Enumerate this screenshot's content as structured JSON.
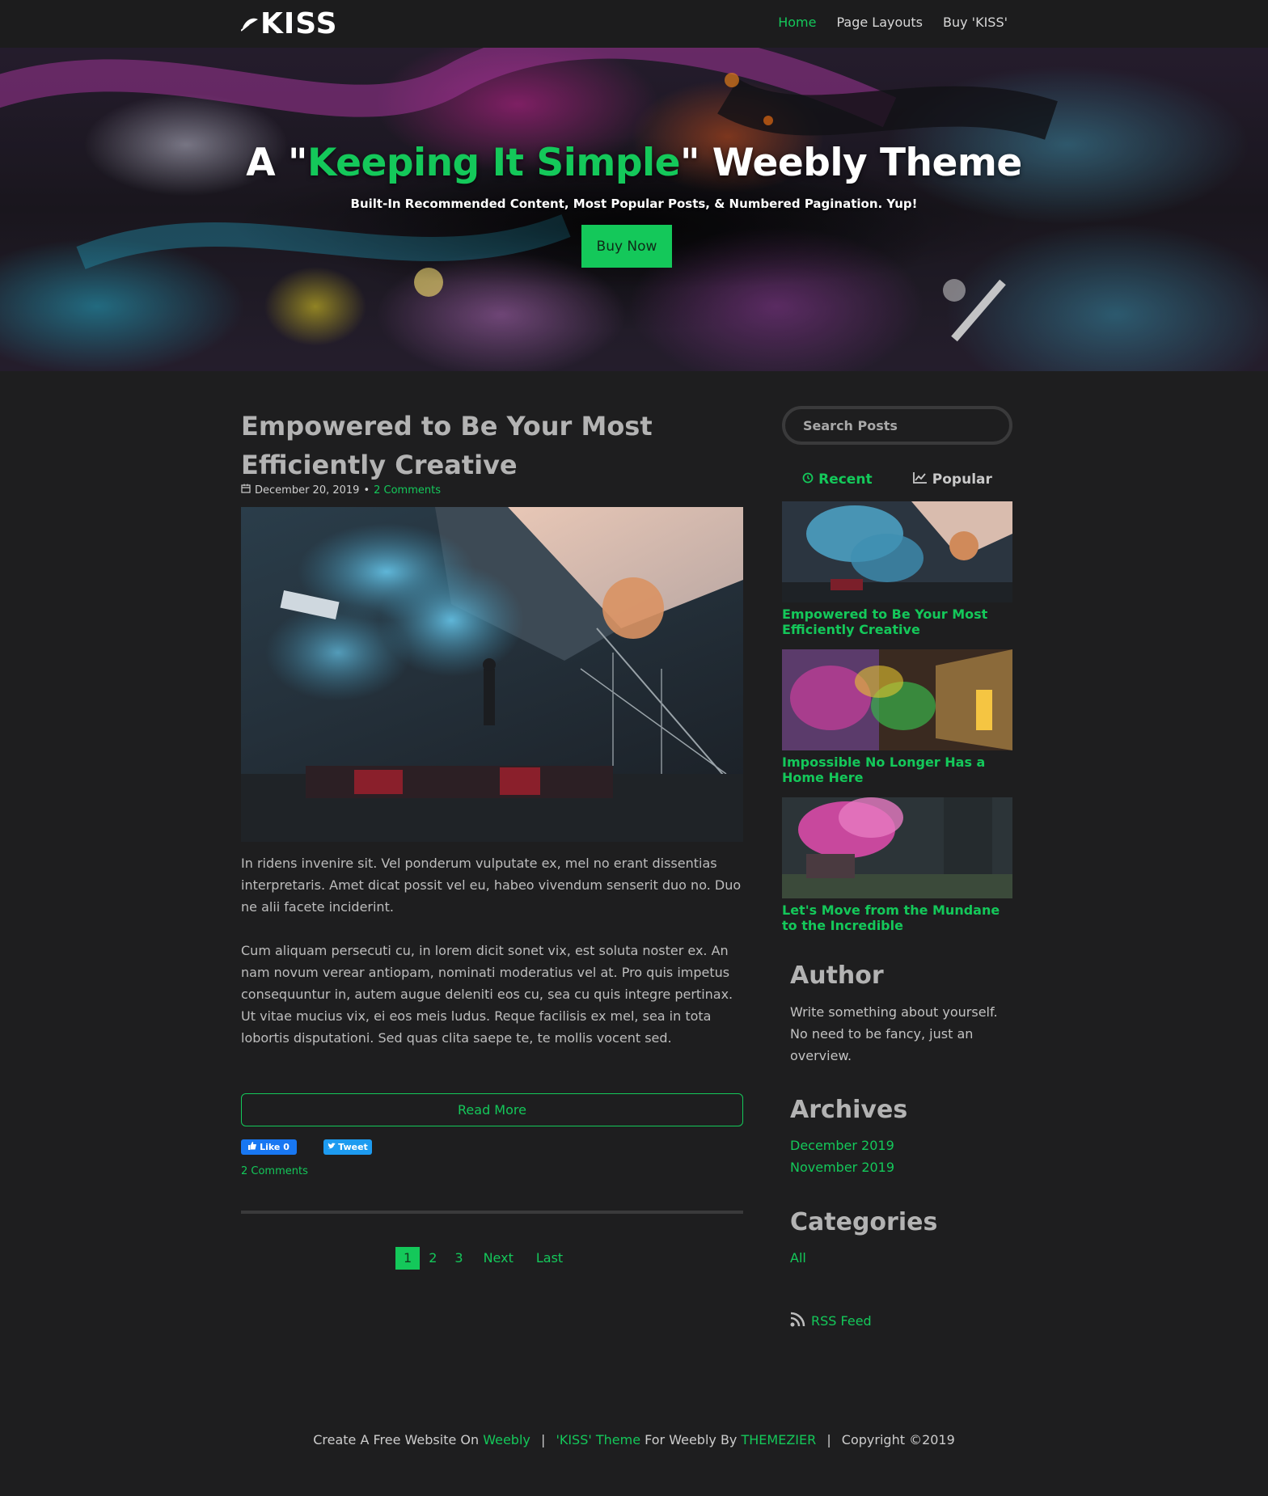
{
  "brand": {
    "logo_text": "KISS"
  },
  "nav": {
    "items": [
      "Home",
      "Page Layouts",
      "Buy 'KISS'"
    ],
    "active": "Home"
  },
  "hero": {
    "title_before": "A \"",
    "title_highlight": "Keeping It Simple",
    "title_after": "\" Weebly Theme",
    "subtitle": "Built-In Recommended Content, Most Popular Posts, & Numbered Pagination. Yup!",
    "button": "Buy Now"
  },
  "post": {
    "title": "Empowered to Be Your Most Efficiently Creative",
    "date": "December 20, 2019",
    "bullet": "•",
    "comments": "2 Comments",
    "paragraphs": [
      "In ridens invenire sit. Vel ponderum vulputate ex, mel no erant dissentias interpretaris. Amet dicat possit vel eu, habeo vivendum senserit duo no. Duo ne alii facete inciderint.",
      "Cum aliquam persecuti cu, in lorem dicit sonet vix, est soluta noster ex. An nam novum verear antiopam, nominati moderatius vel at. Pro quis impetus consequuntur in, autem augue deleniti eos cu, sea cu quis integre pertinax. Ut vitae mucius vix, ei eos meis ludus. Reque facilisis ex mel, sea in tota lobortis disputationi. Sed quas clita saepe te, te mollis vocent sed."
    ],
    "read_more": "Read More",
    "like_label": "Like 0",
    "tweet_label": "Tweet",
    "comments_link": "2 Comments"
  },
  "pagination": {
    "pages": [
      "1",
      "2",
      "3"
    ],
    "current": "1",
    "next": "Next",
    "last": "Last"
  },
  "sidebar": {
    "search_placeholder": "Search Posts",
    "tabs": {
      "recent": "Recent",
      "popular": "Popular"
    },
    "recent_posts": [
      "Empowered to Be Your Most Efficiently Creative",
      "Impossible No Longer Has a Home Here",
      "Let's Move from the Mundane to the Incredible"
    ],
    "author": {
      "heading": "Author",
      "text": "Write something about yourself. No need to be fancy, just an overview."
    },
    "archives": {
      "heading": "Archives",
      "items": [
        "December 2019",
        "November 2019"
      ]
    },
    "categories": {
      "heading": "Categories",
      "items": [
        "All"
      ]
    },
    "rss": "RSS Feed"
  },
  "footer": {
    "part1": "Create A Free Website On",
    "link1": "Weebly",
    "sep": "|",
    "link2": "'KISS' Theme",
    "part2": "For Weebly By",
    "link3": "THEMEZIER",
    "part3": "Copyright ©2019"
  },
  "colors": {
    "accent": "#14c85a",
    "background": "#1e1e1f",
    "header": "#1c1c1d"
  },
  "icons": [
    "leaf-icon",
    "calendar-icon",
    "clock-icon",
    "chart-icon",
    "thumbs-up-icon",
    "bird-icon",
    "rss-icon"
  ]
}
